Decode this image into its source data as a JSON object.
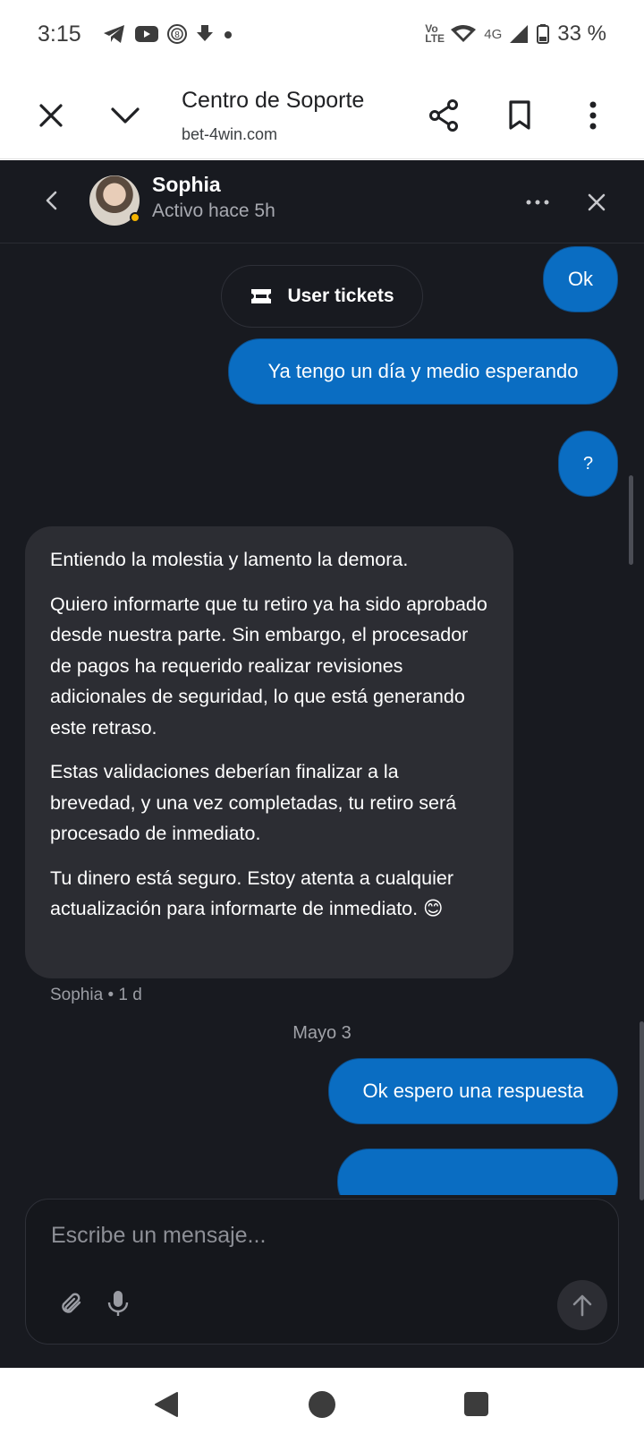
{
  "status_bar": {
    "time": "3:15",
    "volte": "Vo LTE",
    "network": "4G",
    "battery": "33 %"
  },
  "toolbar": {
    "title": "Centro de Soporte",
    "url": "bet-4win.com"
  },
  "chat": {
    "agent_name": "Sophia",
    "agent_status": "Activo hace 5h",
    "tickets_label": "User tickets",
    "messages_out_top": [
      "Ok",
      "Ya tengo un día y medio esperando",
      "?"
    ],
    "incoming_paragraphs": [
      "Entiendo la molestia y lamento la demora.",
      "Quiero informarte que tu retiro ya ha sido aprobado desde nuestra parte. Sin embargo, el procesador de pagos ha requerido realizar revisiones adicionales de seguridad, lo que está generando este retraso.",
      "Estas validaciones deberían finalizar a la brevedad, y una vez completadas, tu retiro será procesado de inmediato.",
      "Tu dinero está seguro. Estoy atenta a cualquier actualización para informarte de inmediato. 😊"
    ],
    "incoming_meta": "Sophia • 1 d",
    "date_separator": "Mayo 3",
    "messages_out_bottom": [
      "Ok espero una respuesta"
    ],
    "composer_placeholder": "Escribe un mensaje..."
  },
  "colors": {
    "chat_bg": "#181a20",
    "outgoing_bubble": "#0a6dc2",
    "incoming_bubble": "#2c2d33",
    "online_dot": "#f5b400"
  },
  "icons": [
    "telegram-icon",
    "youtube-icon",
    "notification-8-icon",
    "download-icon",
    "wifi-icon",
    "signal-icon",
    "battery-icon",
    "close-icon",
    "chevron-down-icon",
    "share-icon",
    "bookmark-icon",
    "more-vert-icon",
    "back-icon",
    "more-horiz-icon",
    "ticket-icon",
    "attach-icon",
    "mic-icon",
    "send-arrow-icon"
  ]
}
